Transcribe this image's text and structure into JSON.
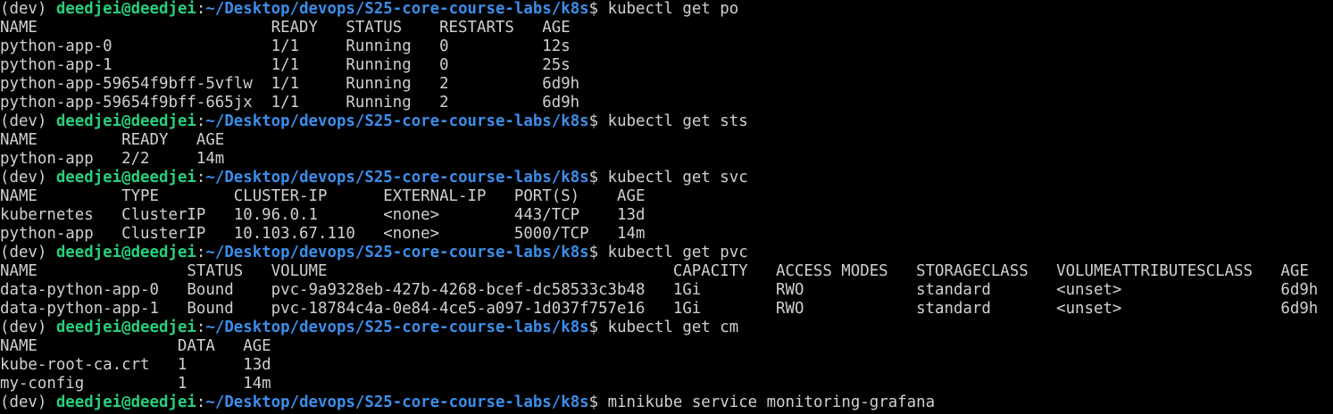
{
  "terminal": {
    "prompt": {
      "env": "(dev) ",
      "user_host": "deedjei@deedjei",
      "colon": ":",
      "path": "~/Desktop/devops/S25-core-course-labs/k8s",
      "dollar": "$ "
    },
    "blocks": [
      {
        "command": "kubectl get po",
        "output": [
          "NAME                         READY   STATUS    RESTARTS   AGE",
          "python-app-0                 1/1     Running   0          12s",
          "python-app-1                 1/1     Running   0          25s",
          "python-app-59654f9bff-5vflw  1/1     Running   2          6d9h",
          "python-app-59654f9bff-665jx  1/1     Running   2          6d9h"
        ]
      },
      {
        "command": "kubectl get sts",
        "output": [
          "NAME         READY   AGE",
          "python-app   2/2     14m"
        ]
      },
      {
        "command": "kubectl get svc",
        "output": [
          "NAME         TYPE        CLUSTER-IP      EXTERNAL-IP   PORT(S)    AGE",
          "kubernetes   ClusterIP   10.96.0.1       <none>        443/TCP    13d",
          "python-app   ClusterIP   10.103.67.110   <none>        5000/TCP   14m"
        ]
      },
      {
        "command": "kubectl get pvc",
        "output": [
          "NAME                STATUS   VOLUME                                     CAPACITY   ACCESS MODES   STORAGECLASS   VOLUMEATTRIBUTESCLASS   AGE",
          "data-python-app-0   Bound    pvc-9a9328eb-427b-4268-bcef-dc58533c3b48   1Gi        RWO            standard       <unset>                 6d9h",
          "data-python-app-1   Bound    pvc-18784c4a-0e84-4ce5-a097-1d037f757e16   1Gi        RWO            standard       <unset>                 6d9h"
        ]
      },
      {
        "command": "kubectl get cm",
        "output": [
          "NAME               DATA   AGE",
          "kube-root-ca.crt   1      13d",
          "my-config          1      14m"
        ]
      },
      {
        "command": "minikube service monitoring-grafana",
        "output": []
      }
    ],
    "colors": {
      "background": "#000000",
      "text": "#d0d0d0",
      "user_host": "#26d07c",
      "path": "#3b8eea"
    }
  }
}
